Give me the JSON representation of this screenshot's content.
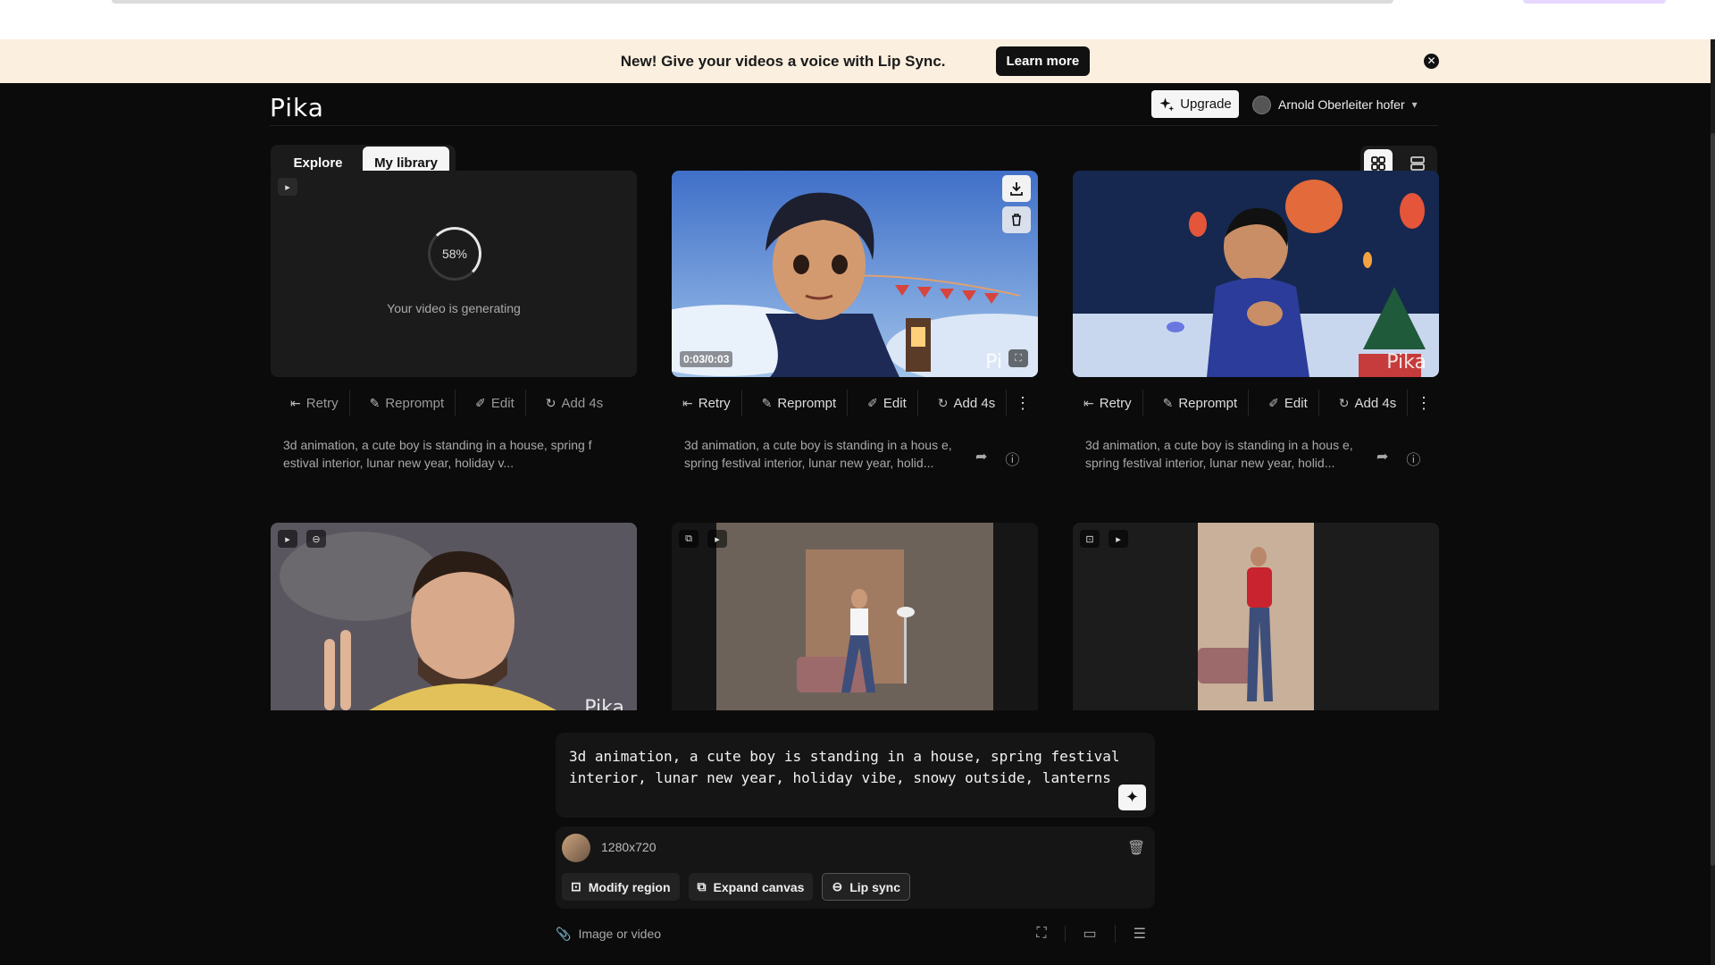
{
  "banner": {
    "message": "New! Give your videos a voice with Lip Sync.",
    "learn_more": "Learn more",
    "close": "✕"
  },
  "header": {
    "logo": "Pika",
    "upgrade": "Upgrade",
    "user_name": "Arnold Oberleiter hofer"
  },
  "tabs": {
    "explore": "Explore",
    "library": "My library"
  },
  "actions": {
    "retry": "Retry",
    "reprompt": "Reprompt",
    "edit": "Edit",
    "add": "Add 4s"
  },
  "cards": [
    {
      "progress_label": "58%",
      "progress": 0.58,
      "status": "Your video is generating",
      "description": "3d animation, a cute boy is standing in a house, spring f estival interior, lunar new year, holiday v..."
    },
    {
      "duration": "0:03/0:03",
      "watermark": "Pi",
      "description": "3d animation, a cute boy is standing in a hous e, spring festival interior, lunar new year, holid..."
    },
    {
      "watermark": "Pika",
      "description": "3d animation, a cute boy is standing in a hous e, spring festival interior, lunar new year, holid..."
    },
    {
      "watermark": "Pika"
    },
    {},
    {}
  ],
  "prompt": {
    "text": "3d animation, a cute boy is standing in a house, spring festival interior, lunar new year, holiday vibe, snowy outside, lanterns"
  },
  "asset": {
    "resolution": "1280x720",
    "modify_region": "Modify region",
    "expand_canvas": "Expand canvas",
    "lip_sync": "Lip sync"
  },
  "bottom": {
    "attach": "Image or video"
  }
}
